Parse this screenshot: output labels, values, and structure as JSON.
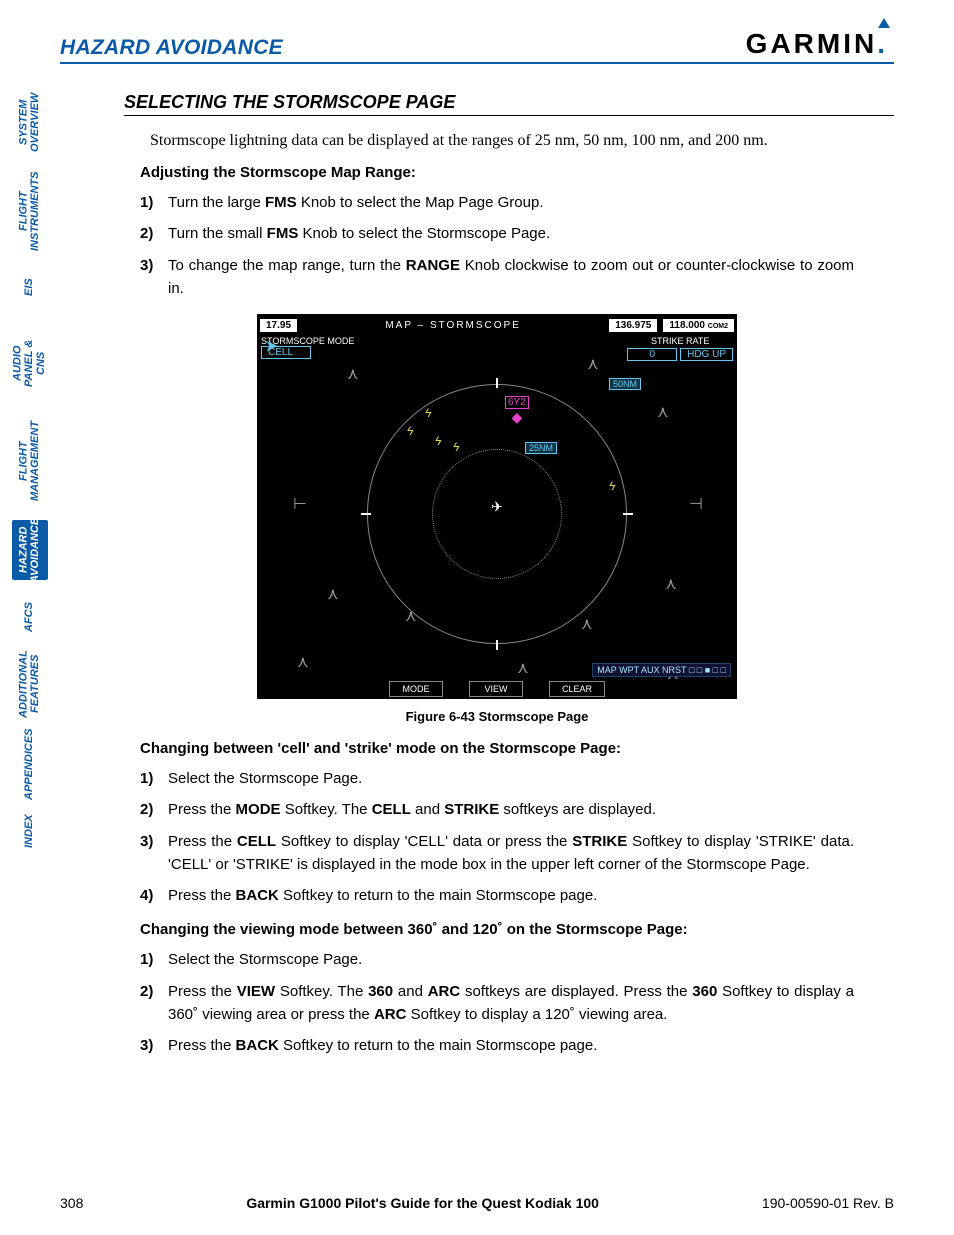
{
  "header": {
    "section": "HAZARD AVOIDANCE",
    "brand": "GARMIN"
  },
  "tabs": [
    {
      "label": "SYSTEM OVERVIEW",
      "active": false,
      "h": "1"
    },
    {
      "label": "FLIGHT INSTRUMENTS",
      "active": false,
      "h": "2"
    },
    {
      "label": "EIS",
      "active": false,
      "h": "s"
    },
    {
      "label": "AUDIO PANEL & CNS",
      "active": false,
      "h": "2"
    },
    {
      "label": "FLIGHT MANAGEMENT",
      "active": false,
      "h": "2"
    },
    {
      "label": "HAZARD AVOIDANCE",
      "active": true,
      "h": "1"
    },
    {
      "label": "AFCS",
      "active": false,
      "h": "s"
    },
    {
      "label": "ADDITIONAL FEATURES",
      "active": false,
      "h": "1"
    },
    {
      "label": "APPENDICES",
      "active": false,
      "h": "1"
    },
    {
      "label": "INDEX",
      "active": false,
      "h": "s"
    }
  ],
  "section_title": "SELECTING THE STORMSCOPE PAGE",
  "intro": "Stormscope lightning data can be displayed at the ranges of 25 nm, 50 nm, 100 nm, and 200 nm.",
  "proc1": {
    "title": "Adjusting the Stormscope Map Range:",
    "steps": [
      {
        "n": "1)",
        "pre": "Turn the large ",
        "b1": "FMS",
        "post": " Knob to select the Map Page Group."
      },
      {
        "n": "2)",
        "pre": "Turn the small ",
        "b1": "FMS",
        "post": " Knob to select the Stormscope Page."
      },
      {
        "n": "3)",
        "pre": "To change the map range, turn the ",
        "b1": "RANGE",
        "post": " Knob clockwise to zoom out or counter-clockwise to zoom in."
      }
    ]
  },
  "figure": {
    "freq_left": "17.95",
    "title": "MAP – STORMSCOPE",
    "freq_r1": "136.975",
    "freq_r2": "118.000",
    "freq_r2_sub": "COM2",
    "mode_label": "STORMSCOPE MODE",
    "mode_val": "CELL",
    "rate_label": "STRIKE RATE",
    "rate_val": "0",
    "ref_label": "HDG UP",
    "wpt": "6Y2",
    "range_inner": "25NM",
    "range_outer": "50NM",
    "nav_strip": "MAP WPT AUX NRST □ □ ■ □ □",
    "soft1": "MODE",
    "soft2": "VIEW",
    "soft3": "CLEAR",
    "caption": "Figure 6-43  Stormscope Page"
  },
  "proc2": {
    "title": "Changing between 'cell' and 'strike' mode on the Stormscope Page:",
    "steps": {
      "s1": "Select the Stormscope Page.",
      "s2a": "Press the ",
      "s2b": "MODE",
      "s2c": " Softkey.  The ",
      "s2d": "CELL",
      "s2e": " and ",
      "s2f": "STRIKE",
      "s2g": " softkeys are displayed.",
      "s3a": "Press the ",
      "s3b": "CELL",
      "s3c": " Softkey to display 'CELL' data or press the ",
      "s3d": "STRIKE",
      "s3e": " Softkey to display 'STRIKE' data.  'CELL' or 'STRIKE' is displayed in the mode box in the upper left corner of the Stormscope Page.",
      "s4a": "Press the ",
      "s4b": "BACK",
      "s4c": " Softkey to return to the main Stormscope page."
    }
  },
  "proc3": {
    "title": "Changing the viewing mode between 360˚ and 120˚ on the Stormscope Page:",
    "steps": {
      "s1": "Select the Stormscope Page.",
      "s2a": "Press the ",
      "s2b": "VIEW",
      "s2c": " Softkey.  The ",
      "s2d": "360",
      "s2e": " and ",
      "s2f": "ARC",
      "s2g": " softkeys are displayed.  Press the ",
      "s2h": "360",
      "s2i": " Softkey to display a 360˚ viewing area or press the ",
      "s2j": "ARC",
      "s2k": " Softkey to display a 120˚ viewing area.",
      "s3a": "Press the ",
      "s3b": "BACK",
      "s3c": " Softkey to return to the main Stormscope page."
    }
  },
  "footer": {
    "page": "308",
    "title": "Garmin G1000 Pilot's Guide for the Quest Kodiak 100",
    "rev": "190-00590-01  Rev. B"
  }
}
